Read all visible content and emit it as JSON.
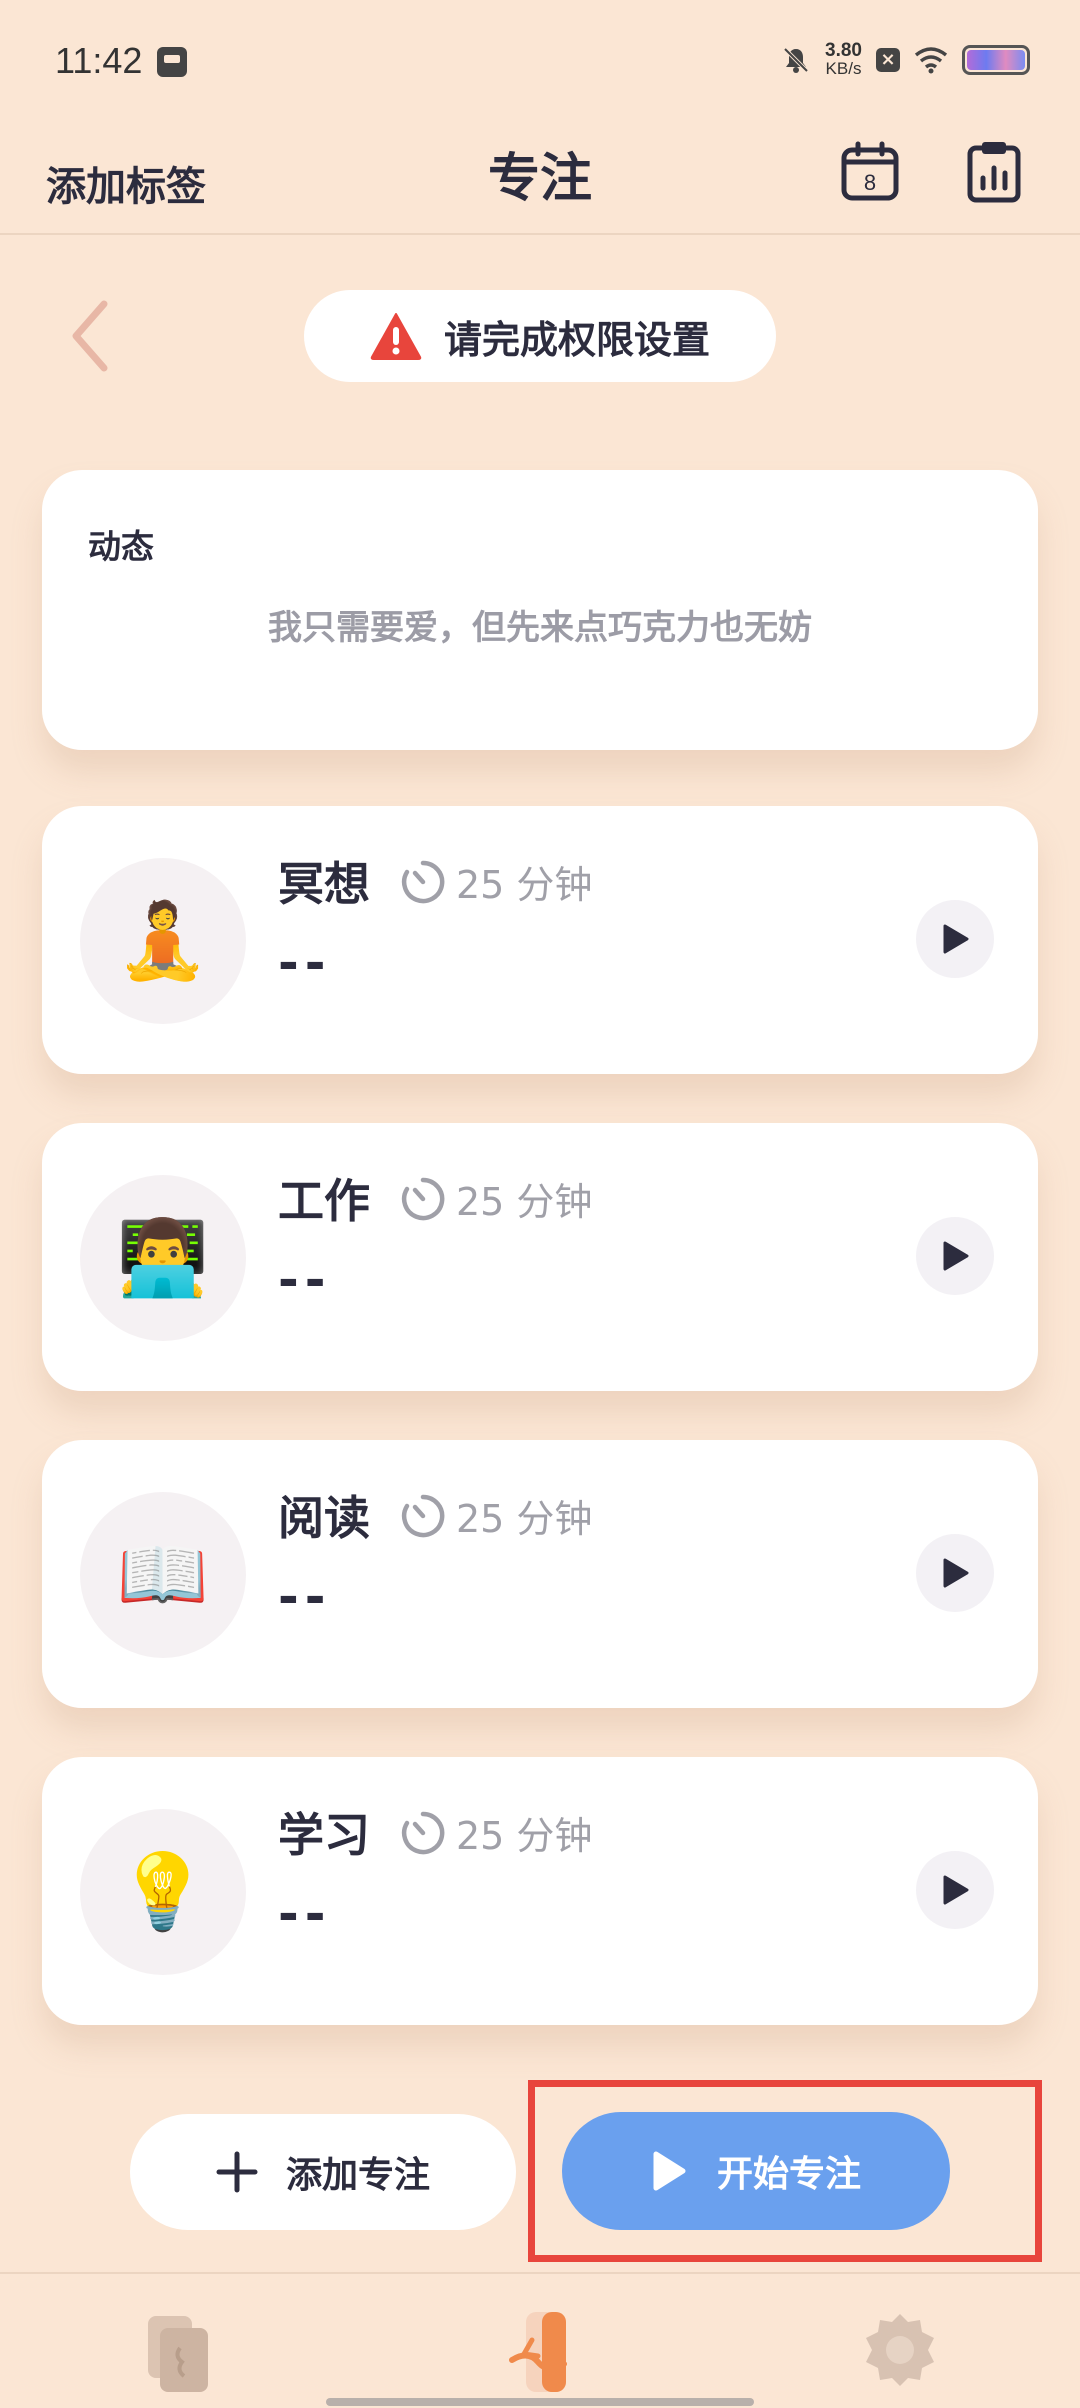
{
  "status_bar": {
    "time": "11:42",
    "net_speed_value": "3.80",
    "net_speed_unit": "KB/s"
  },
  "header": {
    "add_tag_label": "添加标签",
    "title": "专注",
    "calendar_day": "8"
  },
  "permission": {
    "label": "请完成权限设置"
  },
  "dynamic": {
    "title": "动态",
    "quote": "我只需要爱，但先来点巧克力也无妨"
  },
  "focus_items": [
    {
      "name": "冥想",
      "duration": "25 分钟",
      "last": "--",
      "emoji": "🧘"
    },
    {
      "name": "工作",
      "duration": "25 分钟",
      "last": "--",
      "emoji": "👨‍💻"
    },
    {
      "name": "阅读",
      "duration": "25 分钟",
      "last": "--",
      "emoji": "📖"
    },
    {
      "name": "学习",
      "duration": "25 分钟",
      "last": "--",
      "emoji": "💡"
    }
  ],
  "actions": {
    "add_focus_label": "添加专注",
    "start_focus_label": "开始专注"
  },
  "colors": {
    "background": "#fbe6d4",
    "primary_button": "#6aa0ee",
    "highlight": "#e8453c",
    "warning": "#e8453c",
    "nav_active": "#f08a4b"
  }
}
